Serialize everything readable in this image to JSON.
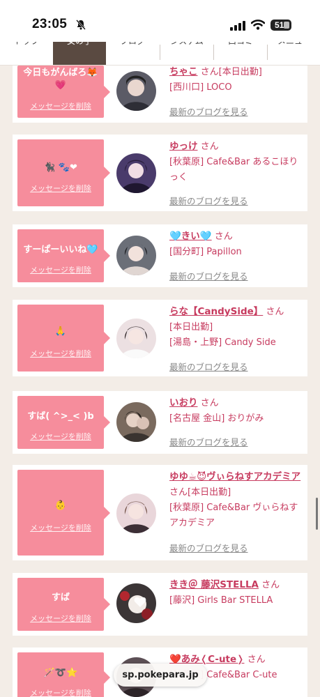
{
  "status_bar": {
    "time": "23:05",
    "battery": "51"
  },
  "tabs": [
    "トップ",
    "女の子",
    "ブログ",
    "システム",
    "口コミ",
    "メニュー"
  ],
  "message_delete_label": "メッセージを削除",
  "blog_link_label": "最新のブログを見る",
  "honorific": "さん",
  "cards": [
    {
      "message": "今日もがんばろ🦊💗",
      "name": "ちゃこ",
      "info_lines": [
        "[西川口] LOCO"
      ],
      "badge": "[本日出勤]",
      "avatar_color": "#5b5b66"
    },
    {
      "message": "🐈‍⬛ 🐾❤",
      "name": "ゆっけ",
      "info_lines": [
        "[秋葉原] Cafe&Bar あるこほりっく"
      ],
      "badge": "",
      "avatar_color": "#4a3b6b"
    },
    {
      "message": "すーぱーいいね🩵",
      "name": "🩵きい🩵",
      "info_lines": [
        "[国分町] Papillon"
      ],
      "badge": "",
      "avatar_color": "#6b6f78"
    },
    {
      "message": "🙏",
      "name": "らな【CandySide】",
      "info_lines": [
        "[本日出勤]",
        "[湯島・上野] Candy Side"
      ],
      "badge": "",
      "avatar_color": "#e8d8da"
    },
    {
      "message": "すば( ^>_< )b",
      "name": "いおり",
      "info_lines": [
        "[名古屋 金山] おりがみ"
      ],
      "badge": "",
      "avatar_color": "#7a6a5e"
    },
    {
      "message": "👶",
      "name": "ゆゆ☕😈ヴぃらねすアカデミア",
      "info_lines": [
        "[秋葉原] Cafe&Bar ヴぃらねすアカデミア"
      ],
      "badge": "[本日出勤]",
      "avatar_color": "#d9c3c8"
    },
    {
      "message": "すば",
      "name": "きき＠ 藤沢STELLA",
      "info_lines": [
        "[藤沢] Girls Bar STELLA"
      ],
      "badge": "",
      "avatar_color": "#3b3536"
    },
    {
      "message": "🪄➰⭐",
      "name": "❤️あみ❬C-ute❭",
      "info_lines": [
        "[秋葉原] Cafe&Bar C-ute"
      ],
      "badge": "",
      "avatar_color": "#5c4f55"
    }
  ],
  "url_pill": "sp.pokepara.jp"
}
